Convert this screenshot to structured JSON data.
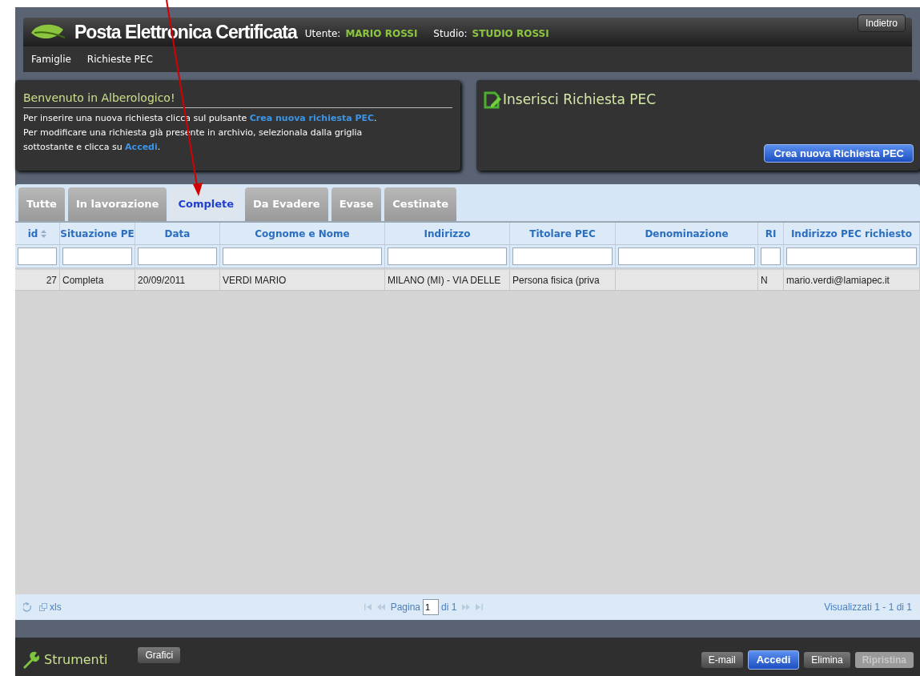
{
  "header": {
    "title": "Posta Elettronica Certificata",
    "user_label": "Utente:",
    "user": "MARIO ROSSI",
    "studio_label": "Studio:",
    "studio": "STUDIO ROSSI",
    "back_button": "Indietro"
  },
  "menu": [
    "Famiglie",
    "Richieste PEC"
  ],
  "welcome": {
    "title": "Benvenuto in Alberologico!",
    "paragraphs": [
      "Per inserire una nuova richiesta clicca sul pulsante **Crea nuova richiesta PEC**.",
      "Per modificare una richiesta già presente in archivio, selezionala dalla griglia sottostante e clicca su **Accedi**."
    ]
  },
  "insert_panel": {
    "title": "Inserisci Richiesta PEC",
    "button": "Crea nuova Richiesta PEC"
  },
  "tabs": [
    {
      "label": "Tutte",
      "selected": false
    },
    {
      "label": "In lavorazione",
      "selected": false
    },
    {
      "label": "Complete",
      "selected": true
    },
    {
      "label": "Da Evadere",
      "selected": false
    },
    {
      "label": "Evase",
      "selected": false
    },
    {
      "label": "Cestinate",
      "selected": false
    }
  ],
  "table": {
    "columns": [
      {
        "label": "id",
        "sorted": true
      },
      {
        "label": "Situazione PE",
        "sorted": false
      },
      {
        "label": "Data",
        "sorted": false
      },
      {
        "label": "Cognome e Nome",
        "sorted": false
      },
      {
        "label": "Indirizzo",
        "sorted": false
      },
      {
        "label": "Titolare PEC",
        "sorted": false
      },
      {
        "label": "Denominazione",
        "sorted": false
      },
      {
        "label": "RI",
        "sorted": false
      },
      {
        "label": "Indirizzo PEC richiesto",
        "sorted": false
      }
    ],
    "rows": [
      [
        "27",
        "Completa",
        "20/09/2011",
        "VERDI MARIO",
        "MILANO (MI) - VIA DELLE",
        "Persona fisica (priva",
        "",
        "N",
        "mario.verdi@lamiapec.it"
      ]
    ]
  },
  "pager": {
    "export": "xls",
    "page_label": "Pagina",
    "page": "1",
    "page_total": "di 1",
    "summary": "Visualizzati 1 - 1 di 1"
  },
  "toolbar": {
    "title": "Strumenti",
    "buttons": [
      "Grafici"
    ],
    "actions": [
      {
        "label": "E-mail",
        "kind": "default",
        "disabled": false
      },
      {
        "label": "Accedi",
        "kind": "primary",
        "disabled": false
      },
      {
        "label": "Elimina",
        "kind": "default",
        "disabled": false
      },
      {
        "label": "Ripristina",
        "kind": "default",
        "disabled": true
      }
    ]
  }
}
